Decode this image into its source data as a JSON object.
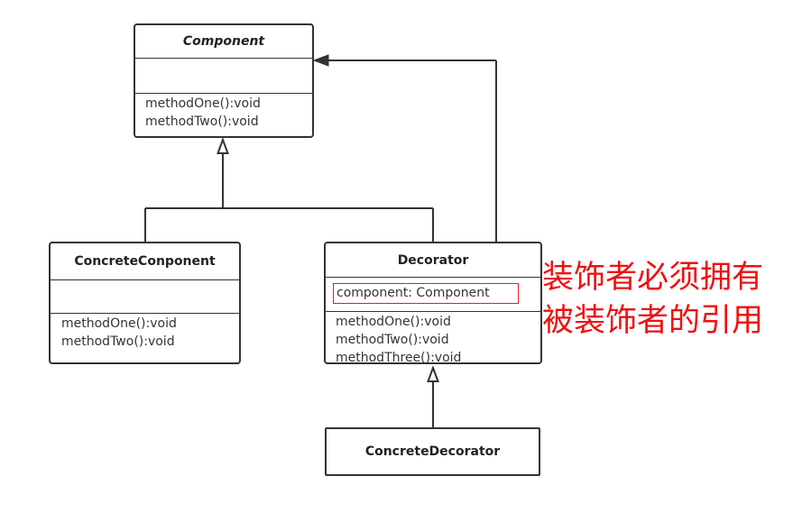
{
  "classes": {
    "component": {
      "name": "Component",
      "attributes": [],
      "methods": [
        "methodOne():void",
        "methodTwo():void"
      ]
    },
    "concrete_component": {
      "name": "ConcreteConponent",
      "attributes": [],
      "methods": [
        "methodOne():void",
        "methodTwo():void"
      ]
    },
    "decorator": {
      "name": "Decorator",
      "attributes": [
        "component: Component"
      ],
      "methods": [
        "methodOne():void",
        "methodTwo():void",
        "methodThree():void"
      ]
    },
    "concrete_decorator": {
      "name": "ConcreteDecorator"
    }
  },
  "relationships": [
    {
      "from": "ConcreteConponent",
      "to": "Component",
      "type": "inheritance"
    },
    {
      "from": "Decorator",
      "to": "Component",
      "type": "inheritance"
    },
    {
      "from": "Decorator",
      "to": "Component",
      "type": "association"
    },
    {
      "from": "ConcreteDecorator",
      "to": "Decorator",
      "type": "inheritance"
    }
  ],
  "annotation": {
    "line1": "装饰者必须拥有",
    "line2": "被装饰者的引用"
  },
  "colors": {
    "line": "#333333",
    "highlight": "#e02020",
    "annotation": "#f01010"
  }
}
